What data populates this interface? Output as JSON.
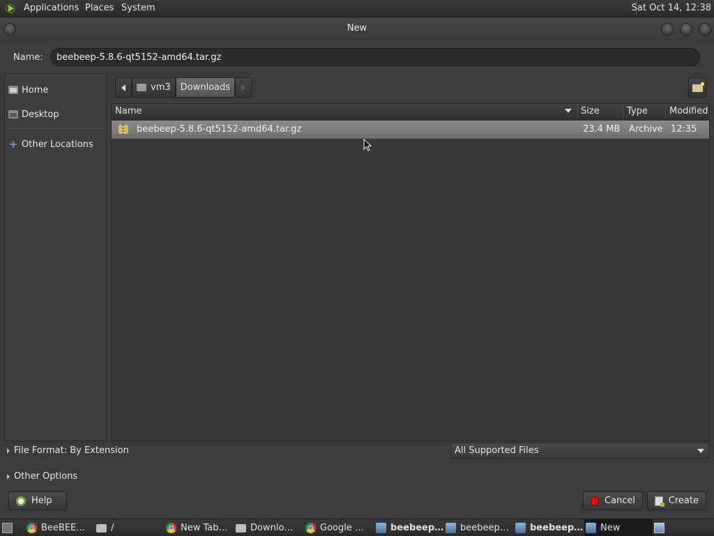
{
  "top_panel": {
    "menus": [
      "Applications",
      "Places",
      "System"
    ],
    "clock": "Sat Oct 14, 12:38"
  },
  "dialog": {
    "title": "New",
    "name_label": "Name:",
    "name_value": "beebeep-5.8.6-qt5152-amd64.tar.gz"
  },
  "sidebar": {
    "items": [
      {
        "label": "Home",
        "icon": "home-folder-icon"
      },
      {
        "label": "Desktop",
        "icon": "desktop-folder-icon"
      },
      {
        "label": "Other Locations",
        "icon": "plus-icon"
      }
    ]
  },
  "pathbar": {
    "segments": [
      "vm3",
      "Downloads"
    ]
  },
  "file_list": {
    "columns": [
      "Name",
      "Size",
      "Type",
      "Modified"
    ],
    "rows": [
      {
        "name": "beebeep-5.8.6-qt5152-amd64.tar.gz",
        "size": "23.4 MB",
        "type": "Archive",
        "modified": "12:35"
      }
    ]
  },
  "options": {
    "file_format": "File Format: By Extension",
    "other_options": "Other Options",
    "filter_value": "All Supported Files"
  },
  "buttons": {
    "help": "Help",
    "cancel": "Cancel",
    "create": "Create"
  },
  "taskbar": {
    "tasks": [
      {
        "label": "BeeBEE…",
        "icon": "chrome-icon"
      },
      {
        "label": "/",
        "icon": "folder-icon"
      },
      {
        "label": "New Tab…",
        "icon": "chrome-icon"
      },
      {
        "label": "Downlo…",
        "icon": "folder-icon"
      },
      {
        "label": "Google …",
        "icon": "chrome-icon"
      },
      {
        "label": "beebeep…",
        "icon": "app-window-icon"
      },
      {
        "label": "beebeep…",
        "icon": "app-window-icon"
      },
      {
        "label": "beebeep…",
        "icon": "app-window-icon"
      },
      {
        "label": "New",
        "icon": "app-window-icon"
      }
    ]
  }
}
